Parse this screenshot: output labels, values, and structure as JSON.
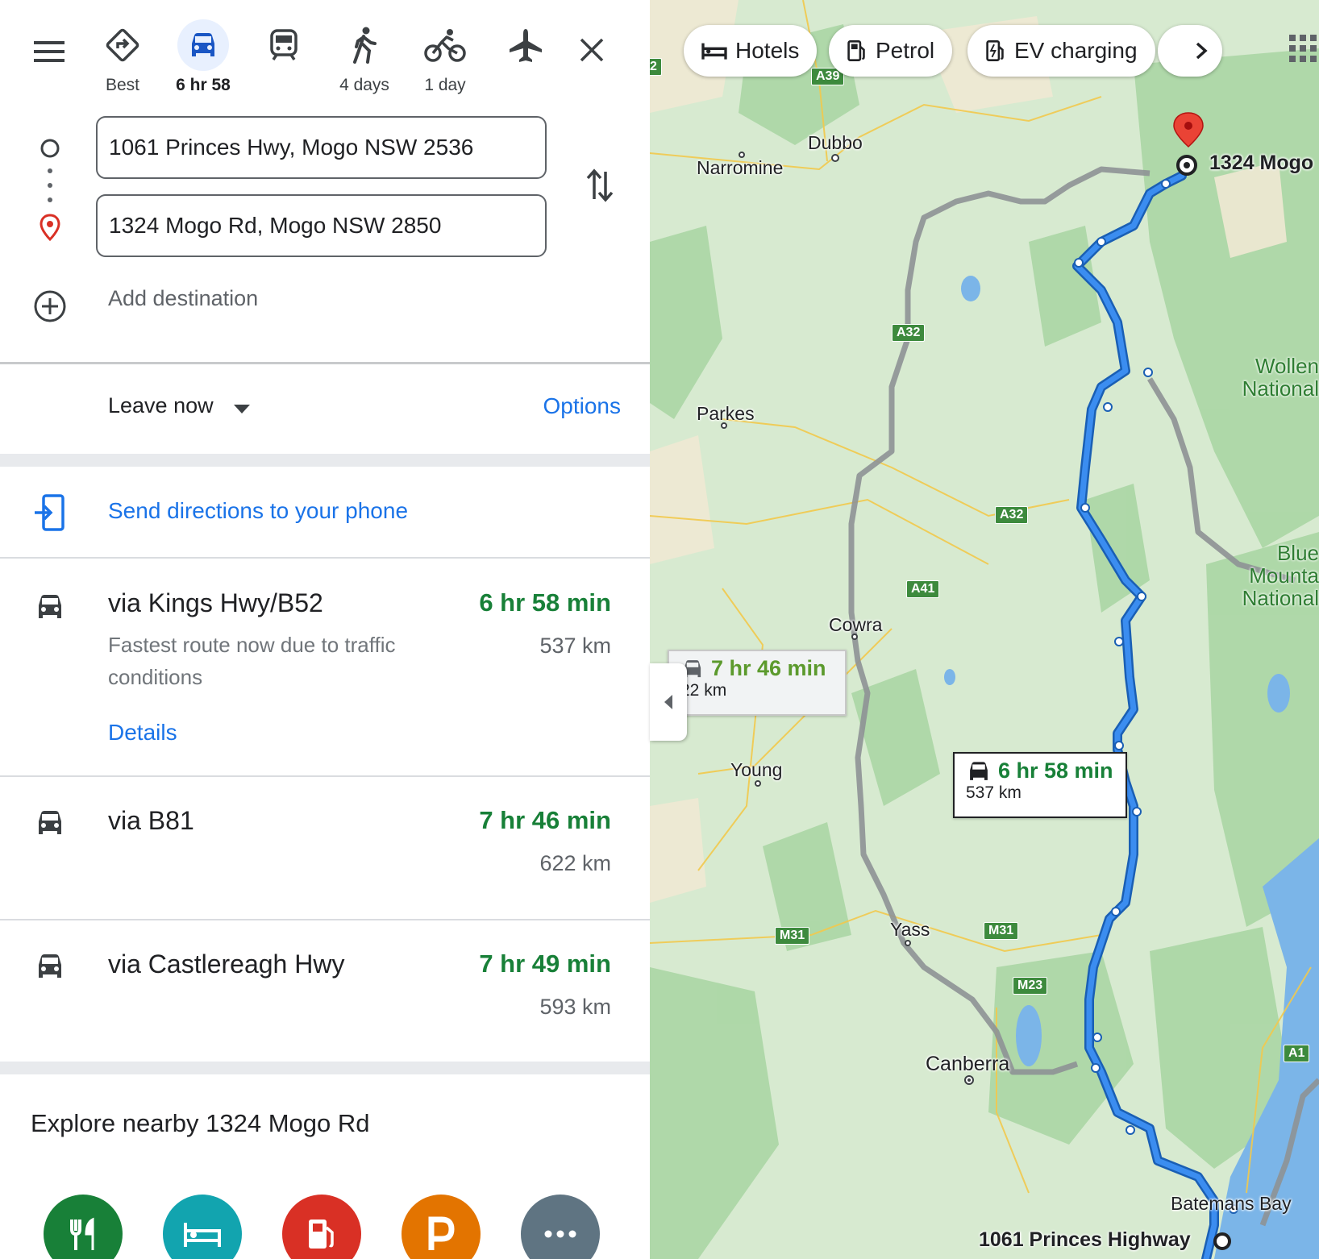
{
  "modes": [
    {
      "name": "best",
      "label": "Best",
      "icon": "directions-diamond-icon"
    },
    {
      "name": "driving",
      "label": "6 hr 58",
      "icon": "car-icon",
      "active": true
    },
    {
      "name": "transit",
      "label": "",
      "icon": "train-icon"
    },
    {
      "name": "walking",
      "label": "4 days",
      "icon": "walking-icon"
    },
    {
      "name": "cycling",
      "label": "1 day",
      "icon": "bicycle-icon"
    },
    {
      "name": "flights",
      "label": "",
      "icon": "airplane-icon"
    }
  ],
  "origin": "1061 Princes Hwy, Mogo NSW 2536",
  "destination": "1324 Mogo Rd, Mogo NSW 2850",
  "add_destination": "Add destination",
  "leave": "Leave now",
  "options": "Options",
  "send": "Send directions to your phone",
  "routes": [
    {
      "title": "via Kings Hwy/B52",
      "time": "6 hr 58 min",
      "distance": "537 km",
      "subtitle": "Fastest route now due to traffic conditions",
      "details": "Details"
    },
    {
      "title": "via B81",
      "time": "7 hr 46 min",
      "distance": "622 km"
    },
    {
      "title": "via Castlereagh Hwy",
      "time": "7 hr 49 min",
      "distance": "593 km"
    }
  ],
  "explore_title": "Explore nearby 1324 Mogo Rd",
  "explore_categories": [
    {
      "icon": "restaurant-icon",
      "color": "#188038"
    },
    {
      "icon": "hotel-icon",
      "color": "#12a4af"
    },
    {
      "icon": "petrol-icon",
      "color": "#d93025"
    },
    {
      "icon": "parking-icon",
      "color": "#e37400"
    },
    {
      "icon": "more-icon",
      "color": "#5f7482"
    }
  ],
  "map": {
    "chips": [
      {
        "label": "Hotels",
        "icon": "hotel-icon"
      },
      {
        "label": "Petrol",
        "icon": "petrol-icon"
      },
      {
        "label": "EV charging",
        "icon": "ev-charging-icon"
      }
    ],
    "cities": [
      "Dubbo",
      "Narromine",
      "Parkes",
      "Cowra",
      "Young",
      "Yass",
      "Canberra",
      "Batemans Bay"
    ],
    "parks": [
      "Wollen\nNational",
      "Blue\nMounta\nNational"
    ],
    "roads": [
      "A39",
      "A32",
      "A32",
      "A41",
      "M31",
      "M31",
      "M23",
      "A1",
      "2"
    ],
    "destination_label": "1324 Mogo",
    "origin_label": "1061 Princes Highway",
    "primary_callout": {
      "time": "6 hr 58 min",
      "distance": "537 km"
    },
    "alt_callout": {
      "time": "7 hr 46 min",
      "distance": "22 km"
    },
    "colors": {
      "route": "#1a73e8",
      "alt_route": "#9aa0a6",
      "land": "#d7ead0",
      "park": "#a8d5a2",
      "water": "#7bb5e8",
      "road": "#f2c94c"
    }
  }
}
